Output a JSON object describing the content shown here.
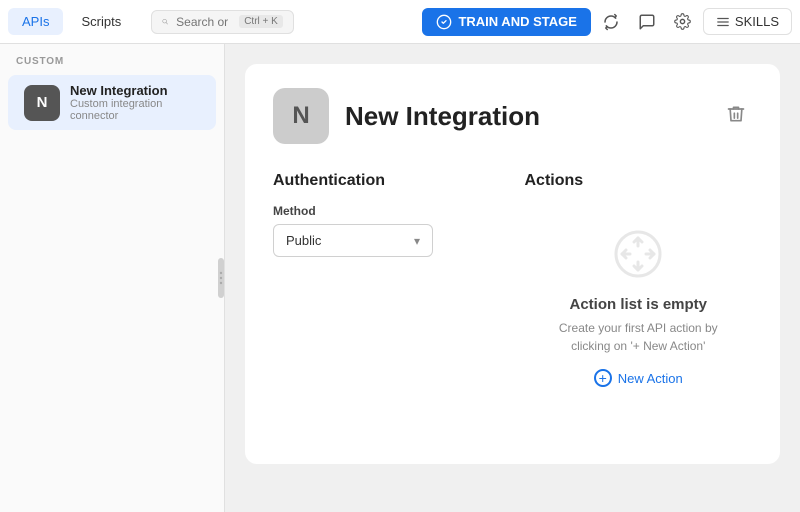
{
  "topbar": {
    "tab_apis": "APIs",
    "tab_scripts": "Scripts",
    "search_placeholder": "Search or type a command...",
    "keyboard_shortcut": "Ctrl + K",
    "train_btn_label": "TRAIN AND STAGE",
    "skills_btn_label": "SKILLS"
  },
  "sidebar": {
    "section_label": "CUSTOM",
    "item": {
      "avatar_letter": "N",
      "name": "New Integration",
      "subtitle": "Custom integration connector"
    }
  },
  "content": {
    "integration": {
      "avatar_letter": "N",
      "title": "New Integration"
    },
    "authentication": {
      "section_title": "Authentication",
      "method_label": "Method",
      "method_value": "Public"
    },
    "actions": {
      "section_title": "Actions",
      "empty_title": "Action list is empty",
      "empty_sub": "Create your first API action by clicking on '+ New Action'",
      "new_action_label": "New Action"
    }
  }
}
